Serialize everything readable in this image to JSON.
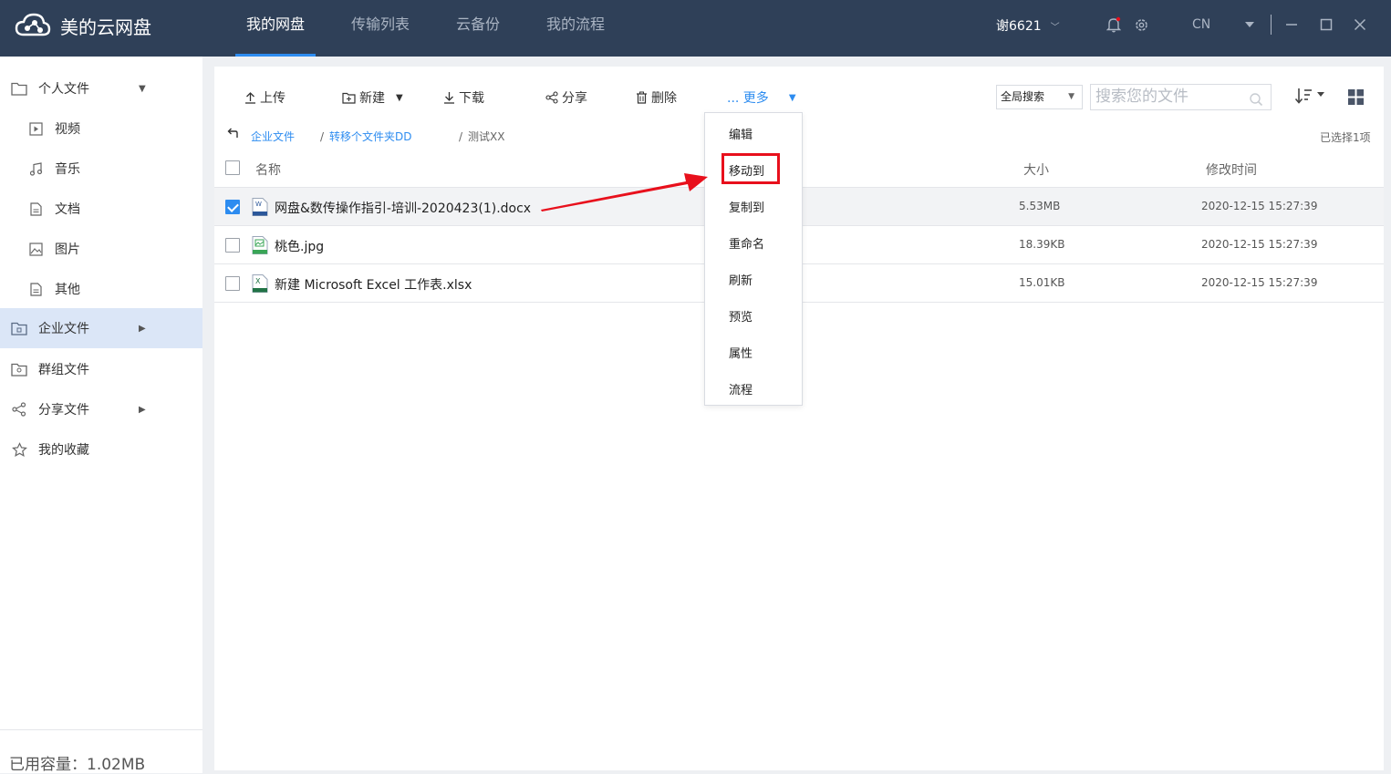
{
  "app": {
    "title": "美的云网盘"
  },
  "nav": {
    "tabs": [
      {
        "label": "我的网盘"
      },
      {
        "label": "传输列表"
      },
      {
        "label": "云备份"
      },
      {
        "label": "我的流程"
      }
    ]
  },
  "header": {
    "user": "谢6621",
    "lang": "CN"
  },
  "sidebar": {
    "items": [
      {
        "label": "个人文件",
        "icon": "folder-icon"
      },
      {
        "label": "视频",
        "icon": "video-icon"
      },
      {
        "label": "音乐",
        "icon": "music-icon"
      },
      {
        "label": "文档",
        "icon": "document-icon"
      },
      {
        "label": "图片",
        "icon": "image-icon"
      },
      {
        "label": "其他",
        "icon": "other-icon"
      },
      {
        "label": "企业文件",
        "icon": "enterprise-folder-icon"
      },
      {
        "label": "群组文件",
        "icon": "group-folder-icon"
      },
      {
        "label": "分享文件",
        "icon": "share-icon"
      },
      {
        "label": "我的收藏",
        "icon": "star-icon"
      }
    ],
    "capacity": "已用容量：1.02MB"
  },
  "toolbar": {
    "upload": "上传",
    "new": "新建",
    "download": "下载",
    "share": "分享",
    "delete": "删除",
    "more": "... 更多",
    "scope": "全局搜索",
    "search_placeholder": "搜索您的文件"
  },
  "breadcrumb": {
    "items": [
      "企业文件",
      "转移个文件夹DD",
      "测试XX"
    ],
    "selected": "已选择1项"
  },
  "table": {
    "headers": {
      "name": "名称",
      "size": "大小",
      "time": "修改时间"
    },
    "rows": [
      {
        "name": "网盘&数传操作指引-培训-2020423(1).docx",
        "size": "5.53MB",
        "time": "2020-12-15 15:27:39",
        "type": "word-file-icon",
        "checked": true
      },
      {
        "name": "桃色.jpg",
        "size": "18.39KB",
        "time": "2020-12-15 15:27:39",
        "type": "image-file-icon",
        "checked": false
      },
      {
        "name": "新建 Microsoft Excel 工作表.xlsx",
        "size": "15.01KB",
        "time": "2020-12-15 15:27:39",
        "type": "excel-file-icon",
        "checked": false
      }
    ]
  },
  "more_menu": {
    "items": [
      "编辑",
      "移动到",
      "复制到",
      "重命名",
      "刷新",
      "预览",
      "属性",
      "流程"
    ],
    "highlighted": "移动到"
  },
  "colors": {
    "topbar": "#2f4058",
    "accent": "#2d8cf0",
    "annotation": "#e8101c",
    "active_side": "#dbe6f7"
  }
}
